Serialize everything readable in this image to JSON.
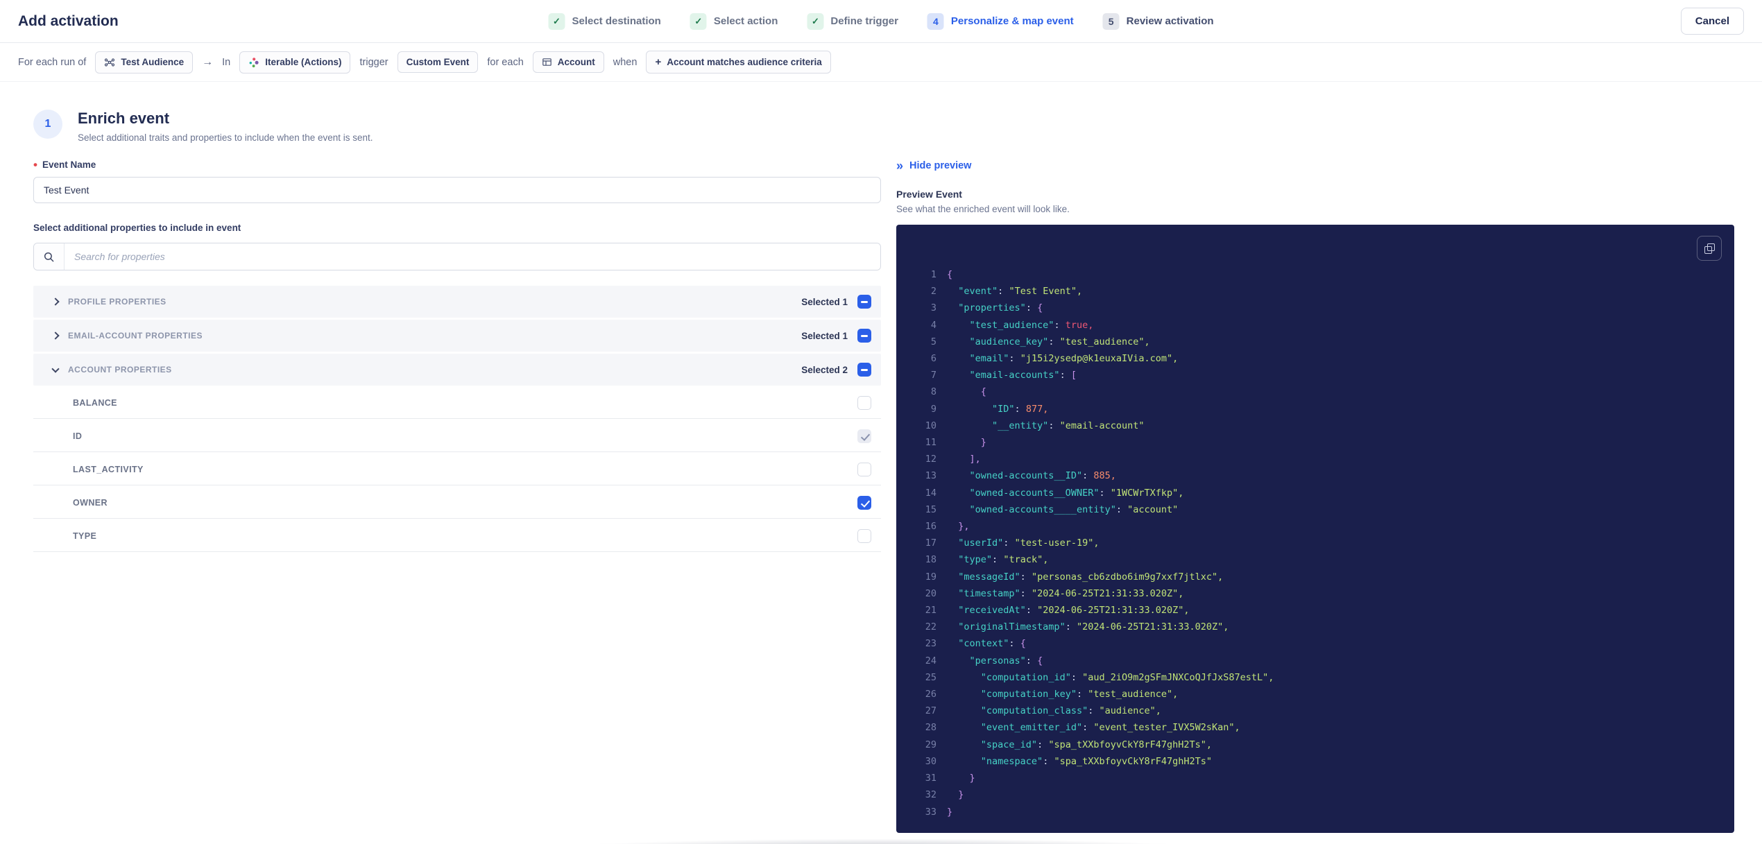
{
  "header": {
    "title": "Add activation",
    "cancel_label": "Cancel",
    "steps": [
      {
        "label": "Select destination",
        "state": "done",
        "number": ""
      },
      {
        "label": "Select action",
        "state": "done",
        "number": ""
      },
      {
        "label": "Define trigger",
        "state": "done",
        "number": ""
      },
      {
        "label": "Personalize & map event",
        "state": "active",
        "number": "4"
      },
      {
        "label": "Review activation",
        "state": "upcoming",
        "number": "5"
      }
    ]
  },
  "context_bar": {
    "prefix": "For each run of",
    "audience_chip": "Test Audience",
    "arrow": "→",
    "in_label": "In",
    "destination_chip": "Iterable (Actions)",
    "trigger_label": "trigger",
    "trigger_chip": "Custom Event",
    "for_each_label": "for each",
    "entity_chip": "Account",
    "criteria_plus": "+",
    "when_label": "when",
    "criteria_chip": "Account matches audience criteria"
  },
  "enrich": {
    "step_number": "1",
    "title": "Enrich event",
    "subtitle": "Select additional traits and properties to include when the event is sent.",
    "event_name_label": "Event Name",
    "event_name_value": "Test Event",
    "properties_label": "Select additional properties to include in event",
    "search_placeholder": "Search for properties",
    "groups": [
      {
        "label": "PROFILE PROPERTIES",
        "selected": "Selected 1",
        "expanded": false
      },
      {
        "label": "EMAIL-ACCOUNT PROPERTIES",
        "selected": "Selected 1",
        "expanded": false
      },
      {
        "label": "ACCOUNT PROPERTIES",
        "selected": "Selected 2",
        "expanded": true
      }
    ],
    "account_properties": [
      {
        "label": "BALANCE",
        "state": "unchecked"
      },
      {
        "label": "ID",
        "state": "checked-disabled"
      },
      {
        "label": "LAST_ACTIVITY",
        "state": "unchecked"
      },
      {
        "label": "OWNER",
        "state": "checked"
      },
      {
        "label": "TYPE",
        "state": "unchecked"
      }
    ]
  },
  "preview": {
    "hide_label": "Hide preview",
    "hide_icon": "»",
    "title": "Preview Event",
    "subtitle": "See what the enriched event will look like.",
    "code_lines": [
      [
        [
          "{",
          "p"
        ]
      ],
      [
        [
          "  ",
          "w"
        ],
        [
          "\"event\"",
          "k"
        ],
        [
          ": ",
          "w"
        ],
        [
          "\"Test Event\",",
          "s"
        ]
      ],
      [
        [
          "  ",
          "w"
        ],
        [
          "\"properties\"",
          "k"
        ],
        [
          ": ",
          "w"
        ],
        [
          "{",
          "p"
        ]
      ],
      [
        [
          "    ",
          "w"
        ],
        [
          "\"test_audience\"",
          "k"
        ],
        [
          ": ",
          "w"
        ],
        [
          "true,",
          "b"
        ]
      ],
      [
        [
          "    ",
          "w"
        ],
        [
          "\"audience_key\"",
          "k"
        ],
        [
          ": ",
          "w"
        ],
        [
          "\"test_audience\",",
          "s"
        ]
      ],
      [
        [
          "    ",
          "w"
        ],
        [
          "\"email\"",
          "k"
        ],
        [
          ": ",
          "w"
        ],
        [
          "\"j15i2ysedp@k1euxaIVia.com\",",
          "s"
        ]
      ],
      [
        [
          "    ",
          "w"
        ],
        [
          "\"email-accounts\"",
          "k"
        ],
        [
          ": ",
          "w"
        ],
        [
          "[",
          "p"
        ]
      ],
      [
        [
          "      ",
          "w"
        ],
        [
          "{",
          "p"
        ]
      ],
      [
        [
          "        ",
          "w"
        ],
        [
          "\"ID\"",
          "k"
        ],
        [
          ": ",
          "w"
        ],
        [
          "877,",
          "n"
        ]
      ],
      [
        [
          "        ",
          "w"
        ],
        [
          "\"__entity\"",
          "k"
        ],
        [
          ": ",
          "w"
        ],
        [
          "\"email-account\"",
          "s"
        ]
      ],
      [
        [
          "      ",
          "w"
        ],
        [
          "}",
          "p"
        ]
      ],
      [
        [
          "    ",
          "w"
        ],
        [
          "],",
          "p"
        ]
      ],
      [
        [
          "    ",
          "w"
        ],
        [
          "\"owned-accounts__ID\"",
          "k"
        ],
        [
          ": ",
          "w"
        ],
        [
          "885,",
          "n"
        ]
      ],
      [
        [
          "    ",
          "w"
        ],
        [
          "\"owned-accounts__OWNER\"",
          "k"
        ],
        [
          ": ",
          "w"
        ],
        [
          "\"1WCWrTXfkp\",",
          "s"
        ]
      ],
      [
        [
          "    ",
          "w"
        ],
        [
          "\"owned-accounts____entity\"",
          "k"
        ],
        [
          ": ",
          "w"
        ],
        [
          "\"account\"",
          "s"
        ]
      ],
      [
        [
          "  ",
          "w"
        ],
        [
          "},",
          "p"
        ]
      ],
      [
        [
          "  ",
          "w"
        ],
        [
          "\"userId\"",
          "k"
        ],
        [
          ": ",
          "w"
        ],
        [
          "\"test-user-19\",",
          "s"
        ]
      ],
      [
        [
          "  ",
          "w"
        ],
        [
          "\"type\"",
          "k"
        ],
        [
          ": ",
          "w"
        ],
        [
          "\"track\",",
          "s"
        ]
      ],
      [
        [
          "  ",
          "w"
        ],
        [
          "\"messageId\"",
          "k"
        ],
        [
          ": ",
          "w"
        ],
        [
          "\"personas_cb6zdbo6im9g7xxf7jtlxc\",",
          "s"
        ]
      ],
      [
        [
          "  ",
          "w"
        ],
        [
          "\"timestamp\"",
          "k"
        ],
        [
          ": ",
          "w"
        ],
        [
          "\"2024-06-25T21:31:33.020Z\",",
          "s"
        ]
      ],
      [
        [
          "  ",
          "w"
        ],
        [
          "\"receivedAt\"",
          "k"
        ],
        [
          ": ",
          "w"
        ],
        [
          "\"2024-06-25T21:31:33.020Z\",",
          "s"
        ]
      ],
      [
        [
          "  ",
          "w"
        ],
        [
          "\"originalTimestamp\"",
          "k"
        ],
        [
          ": ",
          "w"
        ],
        [
          "\"2024-06-25T21:31:33.020Z\",",
          "s"
        ]
      ],
      [
        [
          "  ",
          "w"
        ],
        [
          "\"context\"",
          "k"
        ],
        [
          ": ",
          "w"
        ],
        [
          "{",
          "p"
        ]
      ],
      [
        [
          "    ",
          "w"
        ],
        [
          "\"personas\"",
          "k"
        ],
        [
          ": ",
          "w"
        ],
        [
          "{",
          "p"
        ]
      ],
      [
        [
          "      ",
          "w"
        ],
        [
          "\"computation_id\"",
          "k"
        ],
        [
          ": ",
          "w"
        ],
        [
          "\"aud_2iO9m2gSFmJNXCoQJfJxS87estL\",",
          "s"
        ]
      ],
      [
        [
          "      ",
          "w"
        ],
        [
          "\"computation_key\"",
          "k"
        ],
        [
          ": ",
          "w"
        ],
        [
          "\"test_audience\",",
          "s"
        ]
      ],
      [
        [
          "      ",
          "w"
        ],
        [
          "\"computation_class\"",
          "k"
        ],
        [
          ": ",
          "w"
        ],
        [
          "\"audience\",",
          "s"
        ]
      ],
      [
        [
          "      ",
          "w"
        ],
        [
          "\"event_emitter_id\"",
          "k"
        ],
        [
          ": ",
          "w"
        ],
        [
          "\"event_tester_IVX5W2sKan\",",
          "s"
        ]
      ],
      [
        [
          "      ",
          "w"
        ],
        [
          "\"space_id\"",
          "k"
        ],
        [
          ": ",
          "w"
        ],
        [
          "\"spa_tXXbfoyvCkY8rF47ghH2Ts\",",
          "s"
        ]
      ],
      [
        [
          "      ",
          "w"
        ],
        [
          "\"namespace\"",
          "k"
        ],
        [
          ": ",
          "w"
        ],
        [
          "\"spa_tXXbfoyvCkY8rF47ghH2Ts\"",
          "s"
        ]
      ],
      [
        [
          "    ",
          "w"
        ],
        [
          "}",
          "p"
        ]
      ],
      [
        [
          "  ",
          "w"
        ],
        [
          "}",
          "p"
        ]
      ],
      [
        [
          "}",
          "p"
        ]
      ]
    ]
  },
  "icons": {
    "done_step": "check-icon",
    "audience": "network-nodes-icon",
    "destination": "iterable-logo-icon",
    "entity": "table-grid-icon",
    "search": "search-icon",
    "hide_preview": "double-chevron-right-icon",
    "copy": "copy-icon"
  },
  "colors": {
    "accent_blue": "#2b5fe8",
    "success_green": "#1d7a4c",
    "required_red": "#e5484d",
    "code_background": "#1a1f4c",
    "code_key": "#46d2c6",
    "code_string": "#c0e377",
    "code_number": "#f78c6c",
    "code_boolean": "#ef5874",
    "code_punctuation": "#c792ea"
  }
}
